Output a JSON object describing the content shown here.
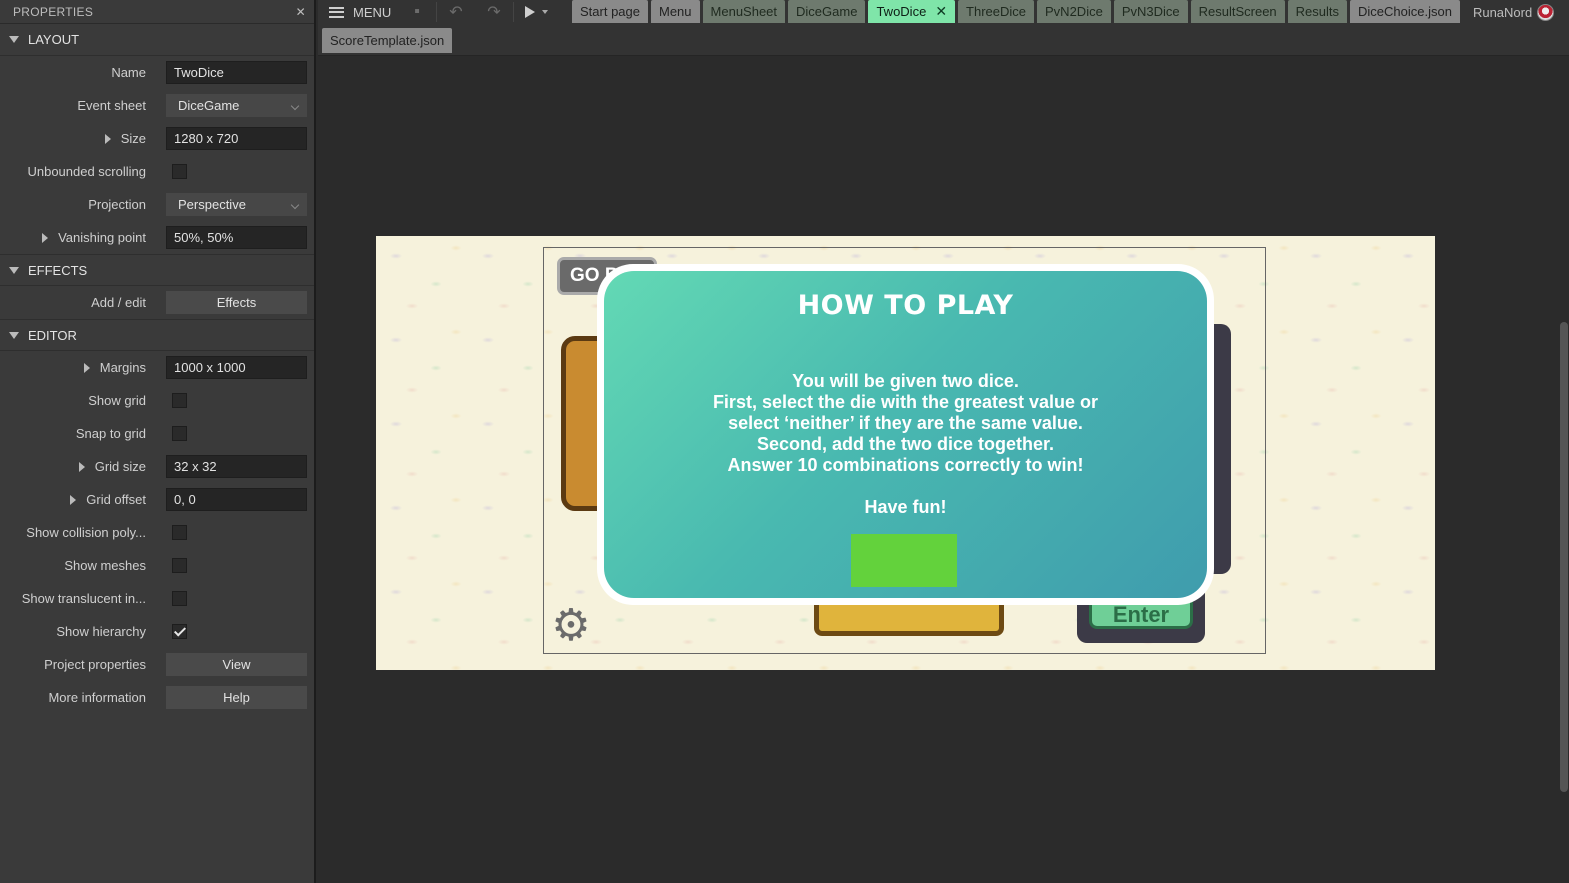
{
  "properties": {
    "title": "PROPERTIES",
    "sections": {
      "layout": "LAYOUT",
      "effects": "EFFECTS",
      "editor": "EDITOR"
    },
    "layout_rows": {
      "name_label": "Name",
      "name_value": "TwoDice",
      "event_sheet_label": "Event sheet",
      "event_sheet_value": "DiceGame",
      "size_label": "Size",
      "size_value": "1280 x 720",
      "unbounded_label": "Unbounded scrolling",
      "projection_label": "Projection",
      "projection_value": "Perspective",
      "vanishing_label": "Vanishing point",
      "vanishing_value": "50%, 50%"
    },
    "effects_rows": {
      "add_edit_label": "Add / edit",
      "effects_button": "Effects"
    },
    "editor_rows": {
      "margins_label": "Margins",
      "margins_value": "1000 x 1000",
      "show_grid_label": "Show grid",
      "snap_grid_label": "Snap to grid",
      "grid_size_label": "Grid size",
      "grid_size_value": "32 x 32",
      "grid_offset_label": "Grid offset",
      "grid_offset_value": "0, 0",
      "collision_label": "Show collision poly...",
      "meshes_label": "Show meshes",
      "translucent_label": "Show translucent in...",
      "hierarchy_label": "Show hierarchy",
      "project_props_label": "Project properties",
      "view_button": "View",
      "more_info_label": "More information",
      "help_button": "Help"
    },
    "checkboxes": {
      "unbounded_scrolling": false,
      "show_grid": false,
      "snap_to_grid": false,
      "show_collision": false,
      "show_meshes": false,
      "show_translucent": false,
      "show_hierarchy": true
    }
  },
  "toolbar": {
    "menu_label": "MENU",
    "icons": [
      "save-icon",
      "undo-icon",
      "redo-icon",
      "play-icon"
    ],
    "tabs": [
      "Start page",
      "Menu",
      "MenuSheet",
      "DiceGame",
      "TwoDice",
      "ThreeDice",
      "PvN2Dice",
      "PvN3Dice",
      "ResultScreen",
      "Results",
      "DiceChoice.json"
    ],
    "active_tab": "TwoDice",
    "user": "RunaNord",
    "tab_row2": [
      "ScoreTemplate.json"
    ],
    "colors": {
      "event_tab": "#6e7a6e",
      "active_tab": "#7fe5a9",
      "file_tab": "#8a8a8a"
    }
  },
  "canvas": {
    "go_back_label": "GO B",
    "enter_label": "Enter",
    "dialog": {
      "title": "HOW TO PLAY",
      "lines": [
        "You will be given two dice.",
        "First, select the die with the greatest value or",
        "select ‘neither’ if they are the same value.",
        "Second, add the two dice together.",
        "Answer 10 combinations correctly to win!"
      ],
      "closing": "Have fun!",
      "ok_color": "#63d23c"
    }
  }
}
